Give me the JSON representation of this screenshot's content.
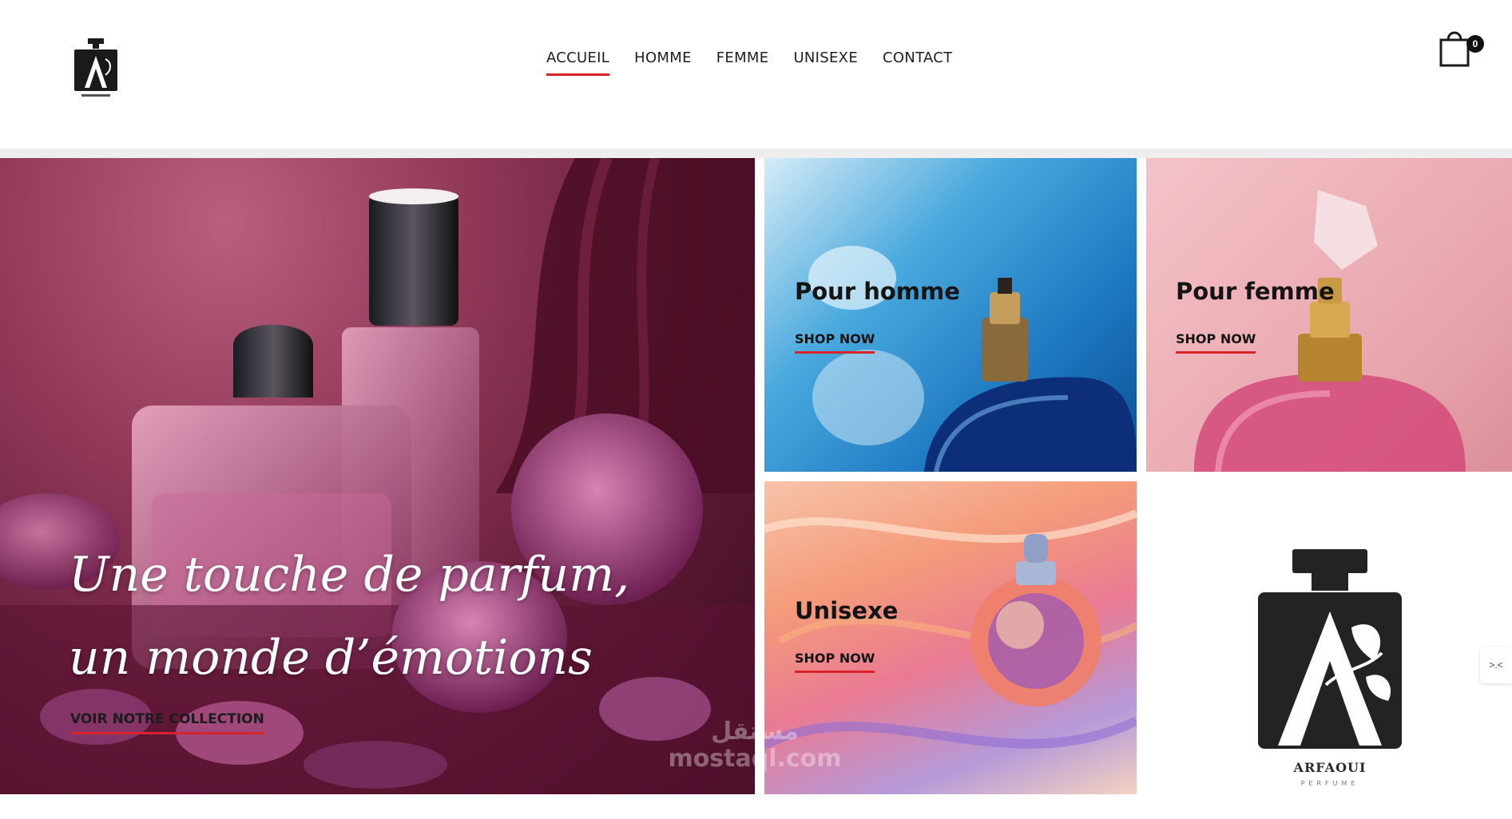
{
  "nav": {
    "items": [
      {
        "label": "ACCUEIL",
        "active": true
      },
      {
        "label": "HOMME",
        "active": false
      },
      {
        "label": "FEMME",
        "active": false
      },
      {
        "label": "UNISEXE",
        "active": false
      },
      {
        "label": "CONTACT",
        "active": false
      }
    ]
  },
  "cart": {
    "count": "0",
    "icon": "shopping-bag-icon"
  },
  "hero": {
    "line1": "Une touche de parfum,",
    "line2": "un monde d’émotions",
    "cta": "VOIR NOTRE COLLECTION"
  },
  "cards": [
    {
      "title": "Pour homme",
      "link": "SHOP NOW"
    },
    {
      "title": "Pour femme",
      "link": "SHOP NOW"
    },
    {
      "title": "Unisexe",
      "link": "SHOP NOW"
    }
  ],
  "brand": {
    "name": "ARFAOUI",
    "sub": "PERFUME"
  },
  "watermark": {
    "line1": "مستقل",
    "line2": "mostaql.com"
  },
  "side_tab": {
    "glyph": ">.<"
  },
  "colors": {
    "accent": "#d8232a",
    "text": "#1e1e1e",
    "divider": "#eeeeef"
  }
}
